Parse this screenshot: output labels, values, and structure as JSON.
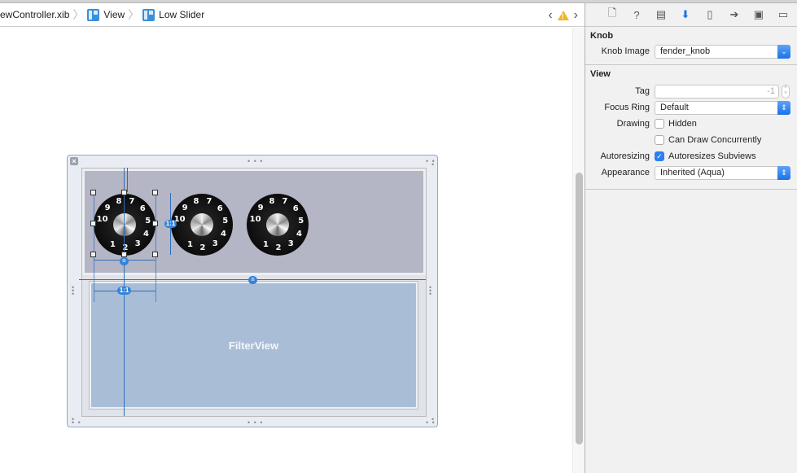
{
  "jumpbar": {
    "crumbs": [
      "ewController.xib",
      "View",
      "Low Slider"
    ],
    "separator": "〉",
    "back_icon": "chevron-left-icon",
    "warning_icon": "warning-icon",
    "forward_icon": "chevron-right-icon",
    "back_glyph": "‹",
    "forward_glyph": "›",
    "warning_glyph": "!"
  },
  "canvas": {
    "filter_view_label": "FilterView",
    "constraint_badges": [
      "1:1",
      "=",
      "=",
      "1:1"
    ],
    "close_glyph": "×",
    "knobs": [
      {
        "numbers": [
          "1",
          "2",
          "3",
          "4",
          "5",
          "6",
          "7",
          "8",
          "9",
          "10"
        ]
      },
      {
        "numbers": [
          "1",
          "2",
          "3",
          "4",
          "5",
          "6",
          "7",
          "8",
          "9",
          "10"
        ]
      },
      {
        "numbers": [
          "1",
          "2",
          "3",
          "4",
          "5",
          "6",
          "7",
          "8",
          "9",
          "10"
        ]
      }
    ]
  },
  "inspector": {
    "tabs": [
      {
        "name": "file-icon",
        "glyph": "🗋"
      },
      {
        "name": "help-icon",
        "glyph": "?"
      },
      {
        "name": "identity-icon",
        "glyph": "▤"
      },
      {
        "name": "attributes-icon",
        "glyph": "⬇",
        "active": true
      },
      {
        "name": "size-icon",
        "glyph": "▯"
      },
      {
        "name": "connections-icon",
        "glyph": "➔"
      },
      {
        "name": "bindings-icon",
        "glyph": "▣"
      },
      {
        "name": "effects-icon",
        "glyph": "▭"
      }
    ],
    "knob_section": {
      "title": "Knob",
      "knob_image_label": "Knob Image",
      "knob_image_value": "fender_knob"
    },
    "view_section": {
      "title": "View",
      "tag_label": "Tag",
      "tag_value": "-1",
      "focus_ring_label": "Focus Ring",
      "focus_ring_value": "Default",
      "drawing_label": "Drawing",
      "hidden_label": "Hidden",
      "hidden_checked": false,
      "can_draw_label": "Can Draw Concurrently",
      "can_draw_checked": false,
      "autoresizing_label": "Autoresizing",
      "autoresizes_label": "Autoresizes Subviews",
      "autoresizes_checked": true,
      "appearance_label": "Appearance",
      "appearance_value": "Inherited (Aqua)"
    }
  }
}
